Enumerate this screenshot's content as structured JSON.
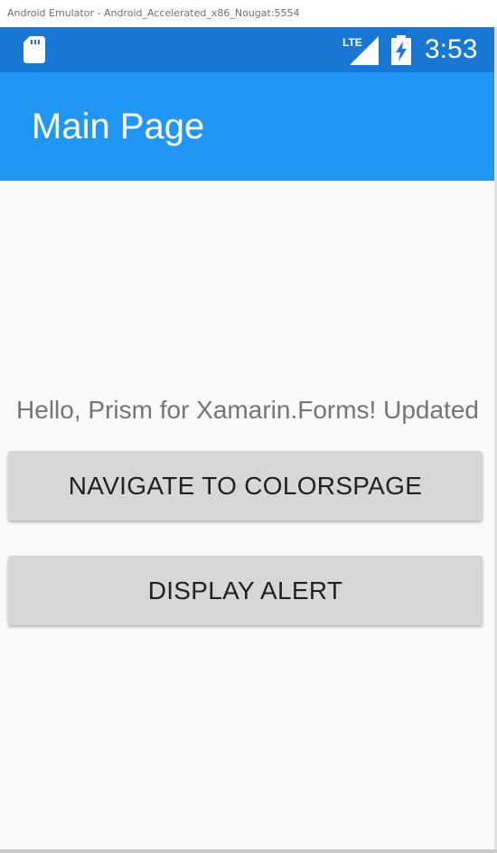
{
  "window": {
    "title": "Android Emulator - Android_Accelerated_x86_Nougat:5554"
  },
  "status_bar": {
    "time": "3:53",
    "network_label": "LTE",
    "icons": [
      "sd-card-icon",
      "lte-signal-icon",
      "battery-charging-icon"
    ],
    "background_color": "#1976d2"
  },
  "app_bar": {
    "title": "Main Page",
    "background_color": "#2196f3"
  },
  "main": {
    "message": "Hello, Prism for Xamarin.Forms! Updated",
    "buttons": {
      "navigate": "NAVIGATE TO COLORSPAGE",
      "alert": "DISPLAY ALERT"
    }
  }
}
